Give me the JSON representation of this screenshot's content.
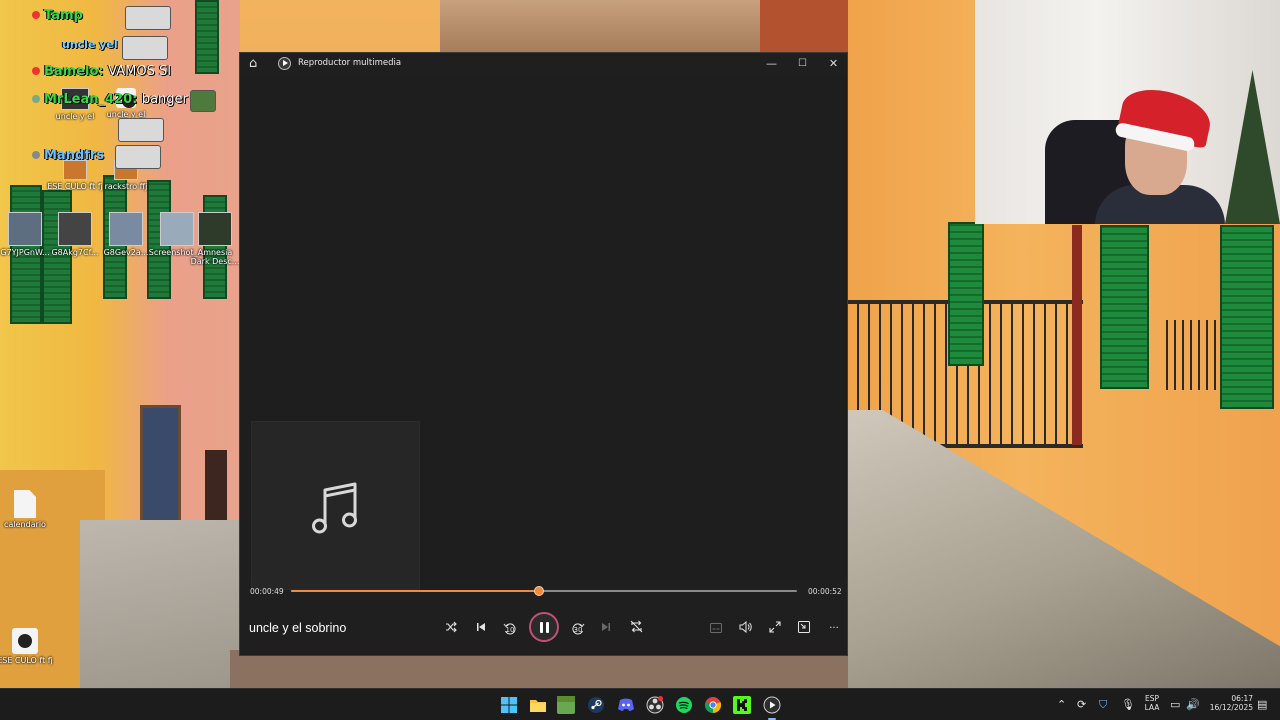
{
  "chat_overlay": {
    "lines": [
      {
        "user": "Tamp",
        "message": ""
      },
      {
        "user": "uncle yel",
        "message": ""
      },
      {
        "user": "Bamelo:",
        "message": "VAMOS SI"
      },
      {
        "user": "MrLean_420:",
        "message": "banger"
      },
      {
        "user": "Mandfrs",
        "message": ""
      }
    ]
  },
  "desktop": {
    "icons": [
      {
        "label": "uncle y el"
      },
      {
        "label": "uncle y el"
      },
      {
        "label": "ESE CULO ft fj"
      },
      {
        "label": "rackstro ffj"
      },
      {
        "label": "G7YJPGnW..."
      },
      {
        "label": "G8Akg7Cf..."
      },
      {
        "label": "G8Gev2a..."
      },
      {
        "label": "Screenshot_..."
      },
      {
        "label": "Amnesia Dark Desc..."
      },
      {
        "label": "calendario"
      },
      {
        "label": "ESE CULO ft fj"
      }
    ]
  },
  "player": {
    "title": "Reproductor multimedia",
    "song_title": "uncle y el sobrino",
    "time_elapsed": "00:00:49",
    "time_total": "00:00:52",
    "progress": 0.49,
    "accent_color": "#f28a3b",
    "titlebar_buttons": {
      "minimize": "—",
      "maximize": "☐",
      "close": "✕"
    },
    "controls": {
      "shuffle_icon": "shuffle-icon",
      "previous_icon": "previous-icon",
      "rewind_label": "10",
      "play_state": "playing",
      "forward_label": "30",
      "next_icon": "next-icon",
      "repeat_icon": "repeat-off-icon",
      "subtitles_icon": "subtitles-icon",
      "volume_icon": "volume-icon",
      "fullscreen_icon": "fullscreen-icon",
      "miniplayer_icon": "miniplayer-icon",
      "more_label": "···"
    }
  },
  "taskbar": {
    "apps": [
      "start-icon",
      "file-explorer-icon",
      "minecraft-icon",
      "steam-icon",
      "discord-icon",
      "obs-icon",
      "spotify-icon",
      "chrome-icon",
      "kick-icon",
      "media-player-icon"
    ],
    "language": {
      "line1": "ESP",
      "line2": "LAA"
    },
    "clock": {
      "time": "06:17",
      "date": "16/12/2025"
    }
  }
}
